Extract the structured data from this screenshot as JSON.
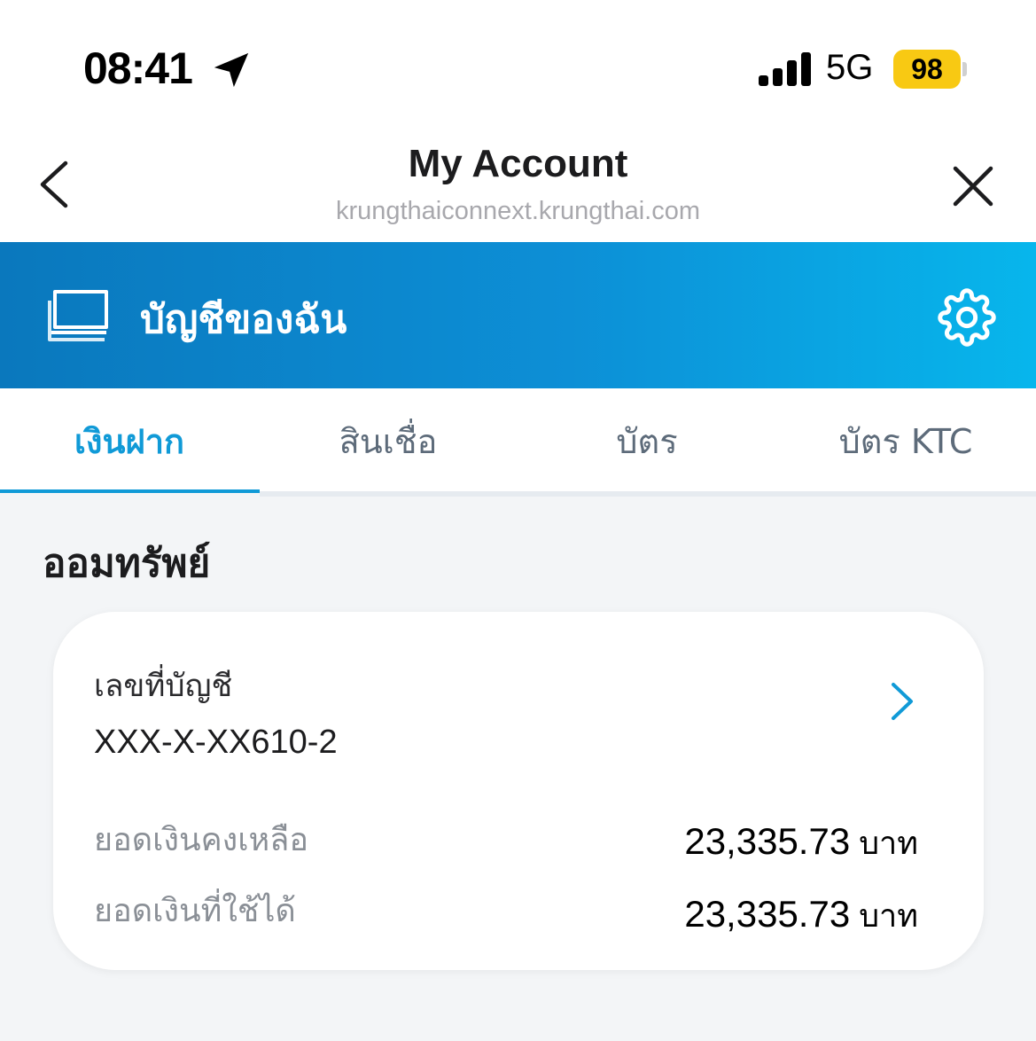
{
  "status_bar": {
    "time": "08:41",
    "network": "5G",
    "battery": "98"
  },
  "nav": {
    "title": "My Account",
    "url": "krungthaiconnext.krungthai.com"
  },
  "banner": {
    "title": "บัญชีของฉัน"
  },
  "tabs": [
    {
      "label": "เงินฝาก",
      "active": true
    },
    {
      "label": "สินเชื่อ",
      "active": false
    },
    {
      "label": "บัตร",
      "active": false
    },
    {
      "label": "บัตร KTC",
      "active": false
    }
  ],
  "section": {
    "title": "ออมทรัพย์"
  },
  "account_card": {
    "account_label": "เลขที่บัญชี",
    "account_number": "XXX-X-XX610-2",
    "balance_label": "ยอดเงินคงเหลือ",
    "balance_value": "23,335.73",
    "available_label": "ยอดเงินที่ใช้ได้",
    "available_value": "23,335.73",
    "currency": "บาท"
  },
  "colors": {
    "accent": "#109ad7",
    "banner_start": "#0a78bd",
    "banner_end": "#07b6ec",
    "battery": "#f8c913"
  }
}
